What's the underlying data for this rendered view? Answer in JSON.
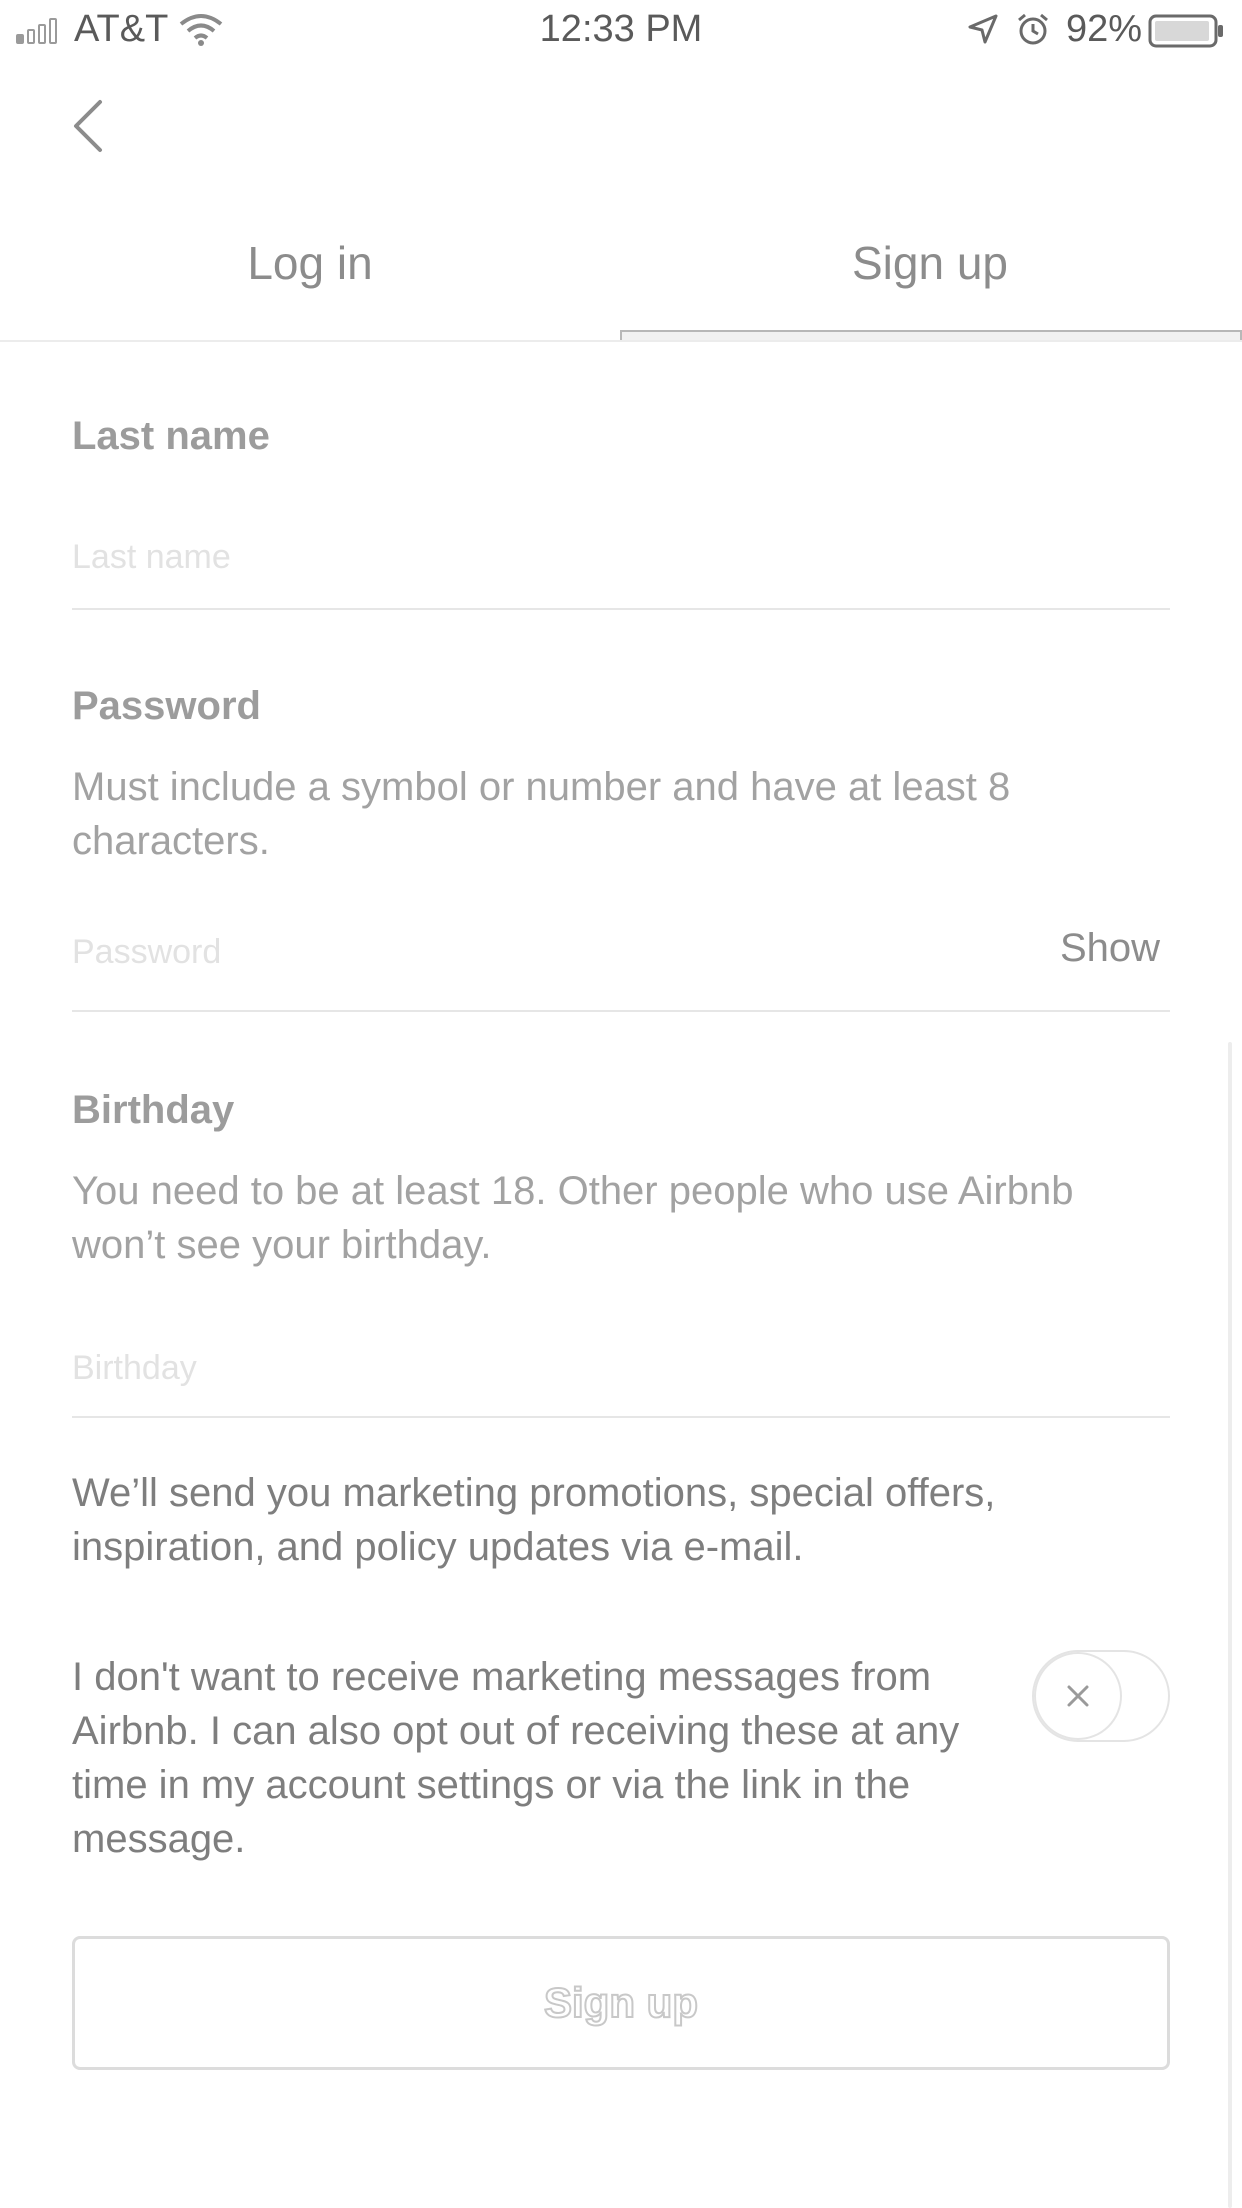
{
  "status_bar": {
    "carrier": "AT&T",
    "time": "12:33 PM",
    "battery": "92%",
    "icons": [
      "signal-icon",
      "wifi-icon",
      "location-arrow-icon",
      "alarm-icon",
      "battery-icon"
    ]
  },
  "header": {
    "back_icon": "chevron-left-icon"
  },
  "tabs": [
    {
      "label": "Log in",
      "selected": false
    },
    {
      "label": "Sign up",
      "selected": true
    }
  ],
  "form": {
    "last_name": {
      "label": "Last name",
      "placeholder": "Last name",
      "value": ""
    },
    "password": {
      "label": "Password",
      "help": "Must include a symbol or number and have at least 8 characters.",
      "placeholder": "Password",
      "value": "",
      "show_label": "Show"
    },
    "birthday": {
      "label": "Birthday",
      "help": "You need to be at least 18. Other people who use Airbnb won’t see your birthday.",
      "placeholder": "Birthday",
      "value": ""
    }
  },
  "marketing": {
    "notice": "We’ll send you marketing promotions, special offers, inspiration, and policy updates via e-mail.",
    "opt_out_text": "I don't want to receive marketing messages from Airbnb. I can also opt out of receiving these at any time in my account settings or via the link in the message.",
    "opt_out_toggle_on": false,
    "toggle_icon": "close-icon"
  },
  "submit": {
    "label": "Sign up"
  }
}
